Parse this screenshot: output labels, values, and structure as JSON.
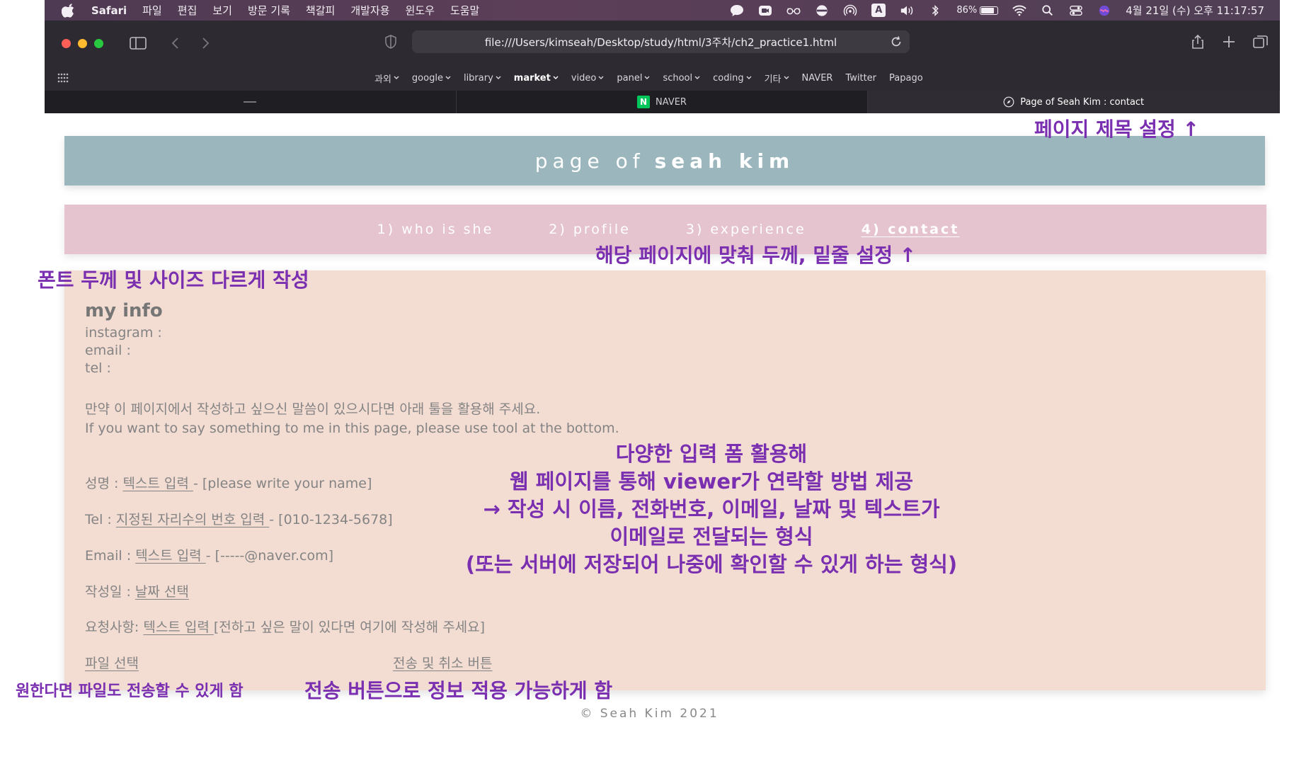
{
  "menubar": {
    "app": "Safari",
    "menus": [
      "파일",
      "편집",
      "보기",
      "방문 기록",
      "책갈피",
      "개발자용",
      "윈도우",
      "도움말"
    ],
    "input_indicator": "A",
    "battery": "86%",
    "battery_level": 0.86,
    "clock": "4월 21일 (수) 오후 11:17:57"
  },
  "browser": {
    "url": "file:///Users/kimseah/Desktop/study/html/3주차/ch2_practice1.html",
    "favorites": [
      {
        "label": "과외",
        "dropdown": true,
        "bold": false
      },
      {
        "label": "google",
        "dropdown": true,
        "bold": false
      },
      {
        "label": "library",
        "dropdown": true,
        "bold": false
      },
      {
        "label": "market",
        "dropdown": true,
        "bold": true
      },
      {
        "label": "video",
        "dropdown": true,
        "bold": false
      },
      {
        "label": "panel",
        "dropdown": true,
        "bold": false
      },
      {
        "label": "school",
        "dropdown": true,
        "bold": false
      },
      {
        "label": "coding",
        "dropdown": true,
        "bold": false
      },
      {
        "label": "기타",
        "dropdown": true,
        "bold": false
      },
      {
        "label": "NAVER",
        "dropdown": false,
        "bold": false
      },
      {
        "label": "Twitter",
        "dropdown": false,
        "bold": false
      },
      {
        "label": "Papago",
        "dropdown": false,
        "bold": false
      }
    ],
    "tabs": [
      {
        "label": "",
        "kind": "blank"
      },
      {
        "label": "NAVER",
        "kind": "naver",
        "logo": "N"
      },
      {
        "label": "Page of Seah Kim : contact",
        "kind": "active"
      }
    ]
  },
  "page": {
    "header_light": "page of",
    "header_bold": "seah kim",
    "nav": [
      "1) who is she",
      "2) profile",
      "3) experience",
      "4) contact"
    ],
    "nav_active": 3,
    "info_heading": "my info",
    "info_lines": [
      "instagram :",
      "email :",
      "tel :"
    ],
    "message_ko": "만약 이 페이지에서 작성하고 싶으신 말씀이 있으시다면 아래 툴을 활용해 주세요.",
    "message_en": "If you want to say something to me in this page, please use tool at the bottom.",
    "form": {
      "name_label": "성명 : ",
      "name_input": "텍스트 입력 ",
      "name_hint": "- [please write your name]",
      "tel_label": "Tel : ",
      "tel_input": "지정된 자리수의 번호 입력 ",
      "tel_hint": "- [010-1234-5678]",
      "email_label": "Email : ",
      "email_input": "텍스트 입력 ",
      "email_hint": "- [-----@naver.com]",
      "date_label": "작성일 : ",
      "date_input": "날짜 선택",
      "request_label": "요청사항: ",
      "request_input": "텍스트 입력 ",
      "request_hint": "[전하고 싶은 말이 있다면 여기에 작성해 주세요]",
      "file_button": "파일 선택",
      "submit_button": "전송 및 취소 버튼"
    },
    "footer": "© Seah Kim 2021"
  },
  "annotations": {
    "title": "페이지 제목 설정 ↑",
    "nav": "해당 페이지에 맞춰 두께, 밑줄 설정 ↑",
    "font": "폰트 두께 및 사이즈 다르게 작성",
    "form_lines": [
      "다양한 입력 폼 활용해",
      "웹 페이지를 통해 viewer가 연락할 방법 제공",
      "→ 작성 시 이름, 전화번호, 이메일, 날짜 및 텍스트가",
      "이메일로 전달되는 형식",
      "(또는 서버에 저장되어 나중에 확인할 수 있게 하는 형식)"
    ],
    "file": "원한다면 파일도 전송할 수 있게 함",
    "submit": "전송 버튼으로 정보 적용 가능하게 함"
  },
  "colors": {
    "header_bg": "#9bb6bc",
    "nav_bg": "#e6c4cf",
    "main_bg": "#f3dcd2",
    "annotation": "#7a2fb0"
  }
}
